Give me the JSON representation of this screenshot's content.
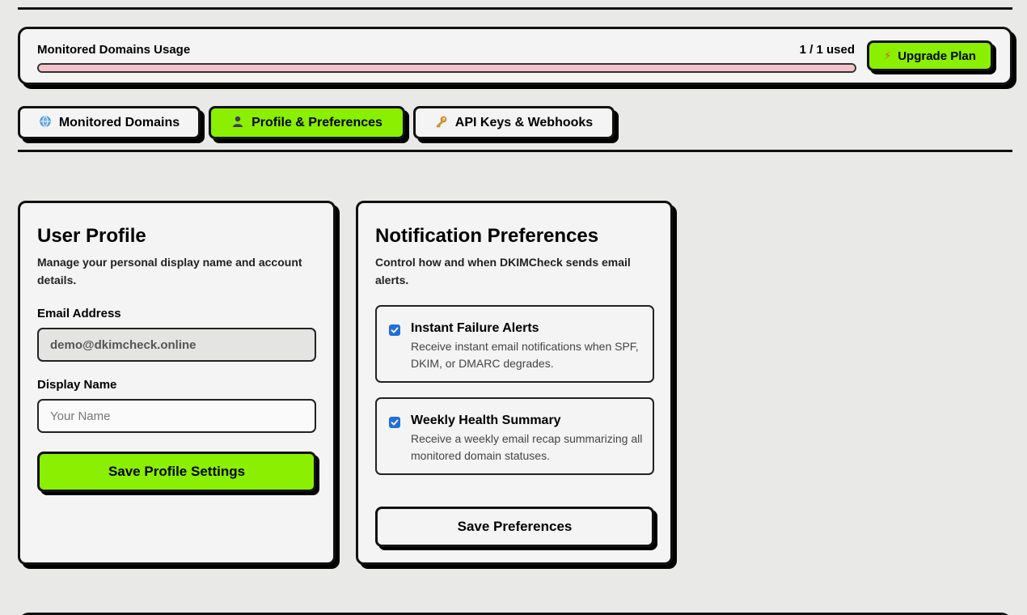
{
  "usage": {
    "title": "Monitored Domains Usage",
    "count_label": "1 / 1 used",
    "used": 1,
    "limit": 1,
    "upgrade_label": "Upgrade Plan",
    "upgrade_icon": "lightning-bolt-icon",
    "bar_color": "#f4c2cc"
  },
  "tabs": [
    {
      "label": "Monitored Domains",
      "icon": "globe-icon",
      "active": false
    },
    {
      "label": "Profile & Preferences",
      "icon": "user-silhouette-icon",
      "active": true
    },
    {
      "label": "API Keys & Webhooks",
      "icon": "key-icon",
      "active": false
    }
  ],
  "profile": {
    "title": "User Profile",
    "description": "Manage your personal display name and account details.",
    "email_label": "Email Address",
    "email_value": "demo@dkimcheck.online",
    "display_name_label": "Display Name",
    "display_name_placeholder": "Your Name",
    "display_name_value": "",
    "save_label": "Save Profile Settings"
  },
  "notifications": {
    "title": "Notification Preferences",
    "description": "Control how and when DKIMCheck sends email alerts.",
    "items": [
      {
        "title": "Instant Failure Alerts",
        "description": "Receive instant email notifications when SPF, DKIM, or DMARC degrades.",
        "checked": true
      },
      {
        "title": "Weekly Health Summary",
        "description": "Receive a weekly email recap summarizing all monitored domain statuses.",
        "checked": true
      }
    ],
    "save_label": "Save Preferences"
  },
  "colors": {
    "accent": "#8aef00",
    "background": "#e9e9e7",
    "checkbox": "#1f6fdc"
  }
}
